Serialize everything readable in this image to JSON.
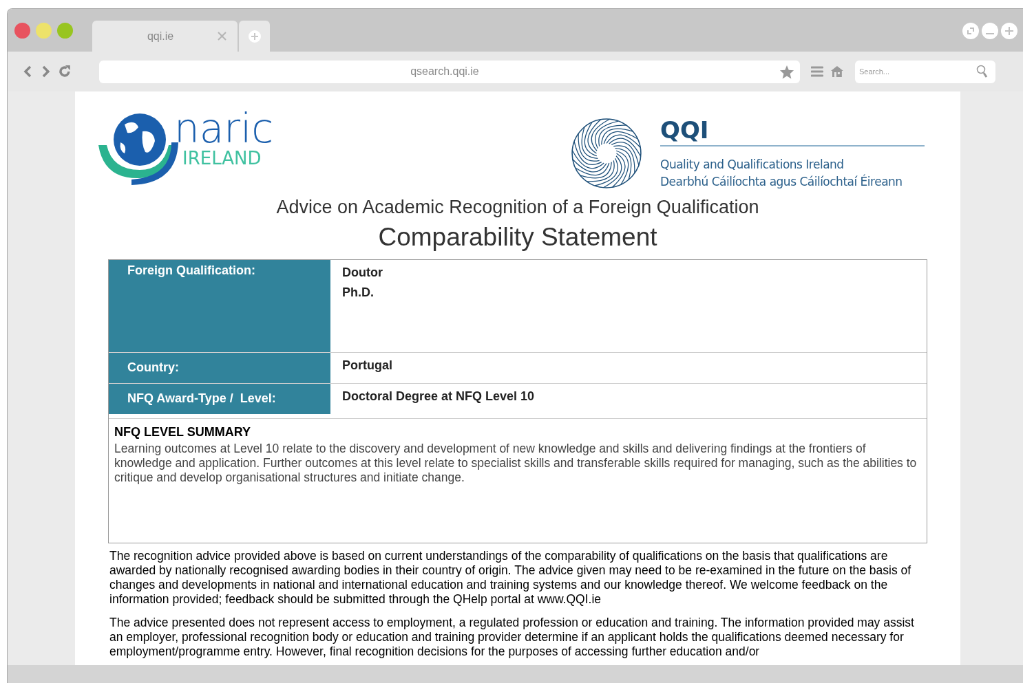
{
  "browser": {
    "tabs": [
      {
        "title": "qqi.ie",
        "selected": true
      }
    ],
    "url": "qsearch.qqi.ie",
    "search": {
      "placeholder": "Search..."
    }
  },
  "logos": {
    "naric": {
      "name": "naric",
      "country": "IRELAND"
    },
    "qqi": {
      "name": "QQI",
      "line_1": "Quality and Qualifications Ireland",
      "line_2": "Dearbhú Cáilíochta agus Cáilíochtaí Éireann"
    }
  },
  "heading": "Advice on Academic Recognition of a Foreign Qualification",
  "title": "Comparability Statement",
  "table": {
    "rows": [
      {
        "label": "Foreign Qualification:",
        "values": [
          "Doutor",
          "Ph.D."
        ]
      },
      {
        "label": "Country:",
        "values": [
          "Portugal"
        ]
      },
      {
        "label": "NFQ Award-Type /  Level:",
        "values": [
          "Doctoral Degree at NFQ Level 10"
        ]
      }
    ]
  },
  "summary": {
    "title": "NFQ LEVEL SUMMARY",
    "text": "Learning outcomes at Level 10 relate to the discovery and development of new knowledge and skills and delivering findings at the frontiers of knowledge and application. Further outcomes at this level relate to specialist skills and transferable skills required for managing, such as the abilities to critique and develop organisational structures and initiate change."
  },
  "paragraphs": [
    "The recognition advice provided above is based on current understandings of the comparability of qualifications on the basis that qualifications are awarded by nationally recognised awarding bodies in their country of origin. The advice given may need to be re-examined in the future on the basis of changes and developments in national and international education and training systems and our knowledge thereof. We welcome feedback on the information provided; feedback should be submitted through the QHelp portal at www.QQI.ie",
    "The advice presented does not represent access to employment, a regulated profession or education and training. The information provided may assist an employer, professional recognition body or education and training provider determine if an applicant holds the qualifications deemed necessary for employment/programme entry. However, final recognition decisions for the purposes of accessing further education and/or"
  ]
}
